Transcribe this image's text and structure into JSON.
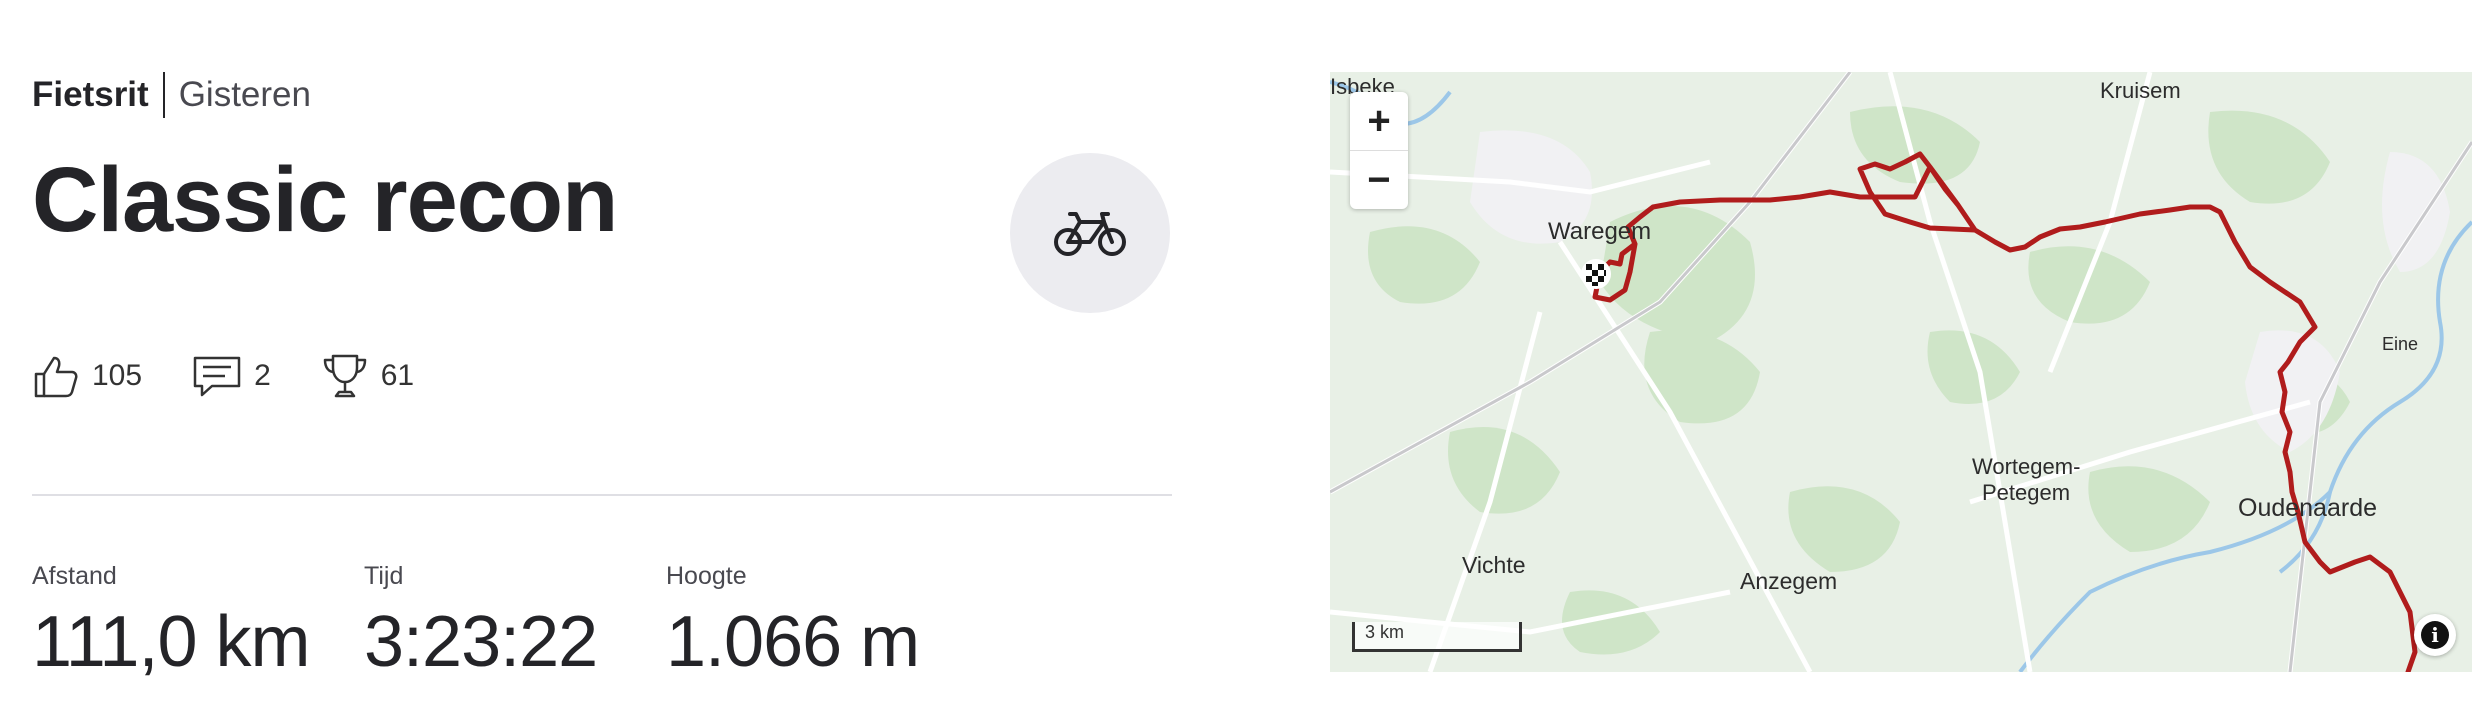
{
  "activity": {
    "type": "Fietsrit",
    "when": "Gisteren",
    "title": "Classic recon",
    "sport_icon": "bike-icon"
  },
  "social": {
    "kudos": "105",
    "comments": "2",
    "achievements": "61"
  },
  "stats": [
    {
      "label": "Afstand",
      "value": "111,0 km"
    },
    {
      "label": "Tijd",
      "value": "3:23:22"
    },
    {
      "label": "Hoogte",
      "value": "1.066 m"
    }
  ],
  "map": {
    "zoom_in": "+",
    "zoom_out": "−",
    "scale": "3 km",
    "info": "i",
    "route_color": "#b01c1c",
    "places": {
      "isbeke": "Isbeke",
      "kruisem": "Kruisem",
      "waregem": "Waregem",
      "eine": "Eine",
      "wortegem": "Wortegem-",
      "petegem": "Petegem",
      "oudenaarde": "Oudenaarde",
      "vichte": "Vichte",
      "anzegem": "Anzegem"
    }
  }
}
